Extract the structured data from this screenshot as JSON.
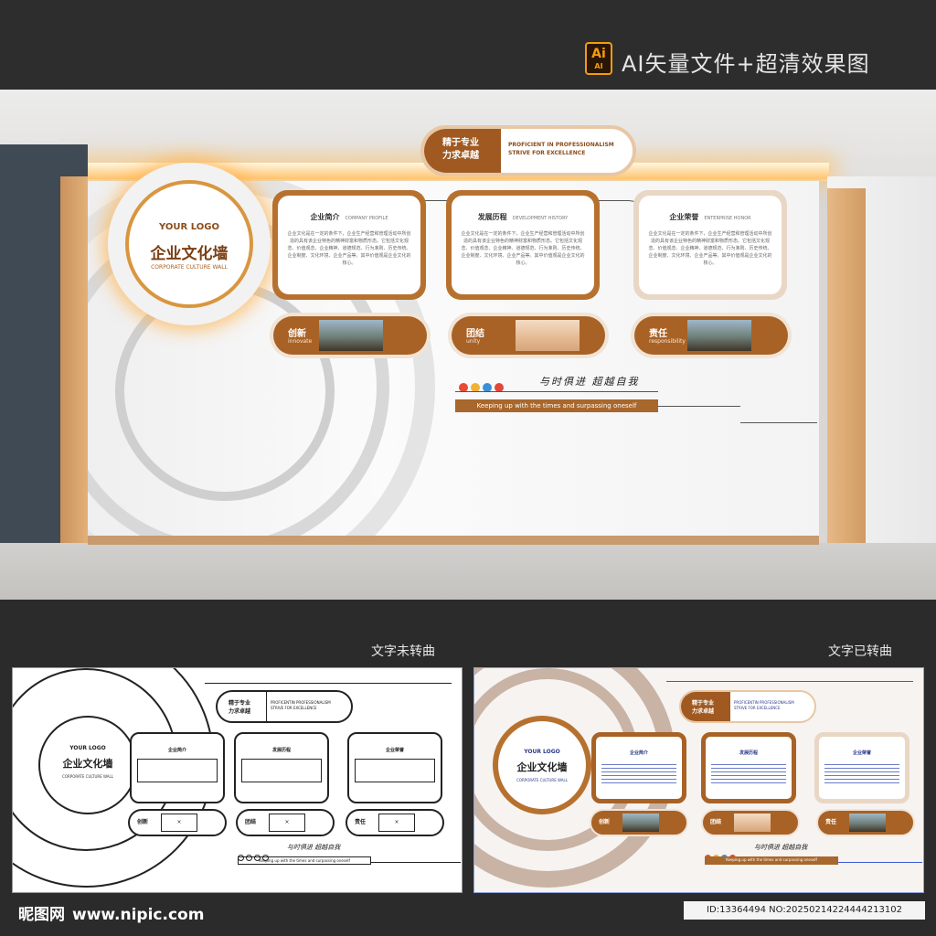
{
  "header": {
    "ai_badge_big": "Ai",
    "ai_badge_small": "AI",
    "caption": "AI矢量文件+超清效果图"
  },
  "wall": {
    "logo": {
      "your_logo": "YOUR LOGO",
      "title": "企业文化墙",
      "subtitle": "CORPORATE CULTURE WALL"
    },
    "motto_pill": {
      "zh_line1": "精于专业",
      "zh_line2": "力求卓越",
      "en_line1": "PROFICIENT IN PROFESSIONALISM",
      "en_line2": "STRIVE FOR EXCELLENCE"
    },
    "cards": [
      {
        "title": "企业简介",
        "title_en": "COMPANY PROFILE"
      },
      {
        "title": "发展历程",
        "title_en": "DEVELOPMENT HISTORY"
      },
      {
        "title": "企业荣誉",
        "title_en": "ENTERPRISE HONOR"
      }
    ],
    "card_body": "企业文化是在一定的条件下，企业生产经营和管理活动中所创造的具有该企业特色的精神财富和物质形态。它包括文化观念、价值观念、企业精神、道德规范、行为准则、历史传统、企业制度、文化环境、企业产品等。其中价值观是企业文化的核心。",
    "bars": [
      {
        "zh": "创新",
        "en": "innovate"
      },
      {
        "zh": "团结",
        "en": "unity"
      },
      {
        "zh": "责任",
        "en": "responsibility"
      }
    ],
    "dot_colors": [
      "#e94b35",
      "#f2b134",
      "#3b8fd9",
      "#e2473a"
    ],
    "slogan_zh": "与时俱进 超越自我",
    "slogan_en": "Keeping up with the times and surpassing oneself"
  },
  "previews": {
    "left_caption": "文字未转曲",
    "right_caption": "文字已转曲",
    "outline": {
      "motto_en_line1": "PROFICENTIN PROFESSIONALISM",
      "motto_en_line2": "STRIVE FOR EXCELLENCE",
      "slogan_en": "Keeping up with the times and surpassing oneself",
      "box_mark": "×"
    },
    "color": {
      "motto_en_line1": "PROFICENTIN PROFESSIONALISM",
      "motto_en_line2": "STRIVE FOR EXCELLENCE",
      "slogan_en": "Keeping up with the times and surpassing oneself"
    }
  },
  "footer": {
    "site_name": "昵图网",
    "site_url": "www.nipic.com",
    "id_text": "ID:13364494 NO:20250214224444213102"
  }
}
